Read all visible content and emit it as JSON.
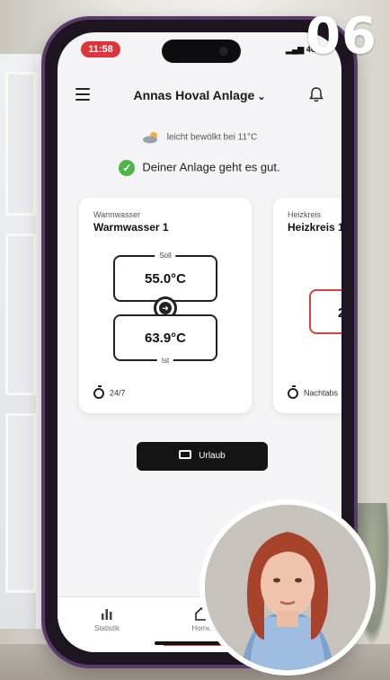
{
  "overlay": {
    "episode_number": "06"
  },
  "status_bar": {
    "time": "11:58",
    "signal": "4G"
  },
  "header": {
    "title": "Annas Hoval Anlage"
  },
  "weather": {
    "text": "leicht bewölkt bei 11°C"
  },
  "system_status": {
    "text": "Deiner Anlage geht es gut."
  },
  "cards": [
    {
      "category": "Warmwasser",
      "name": "Warmwasser 1",
      "soll_label": "Soll",
      "soll_value": "55.0°C",
      "ist_label": "Ist",
      "ist_value": "63.9°C",
      "schedule": "24/7"
    },
    {
      "category": "Heizkreis",
      "name": "Heizkreis 1",
      "value_partial": "2",
      "schedule": "Nachtabs"
    }
  ],
  "vacation_button": {
    "label": "Urlaub"
  },
  "bottom_nav": [
    {
      "label": "Statistik",
      "icon": "bar-chart-icon"
    },
    {
      "label": "Home",
      "icon": "home-icon"
    }
  ],
  "colors": {
    "accent_red": "#d8433c",
    "status_green": "#4fb548",
    "button_dark": "#141414",
    "phone_frame": "#5a3a66"
  }
}
